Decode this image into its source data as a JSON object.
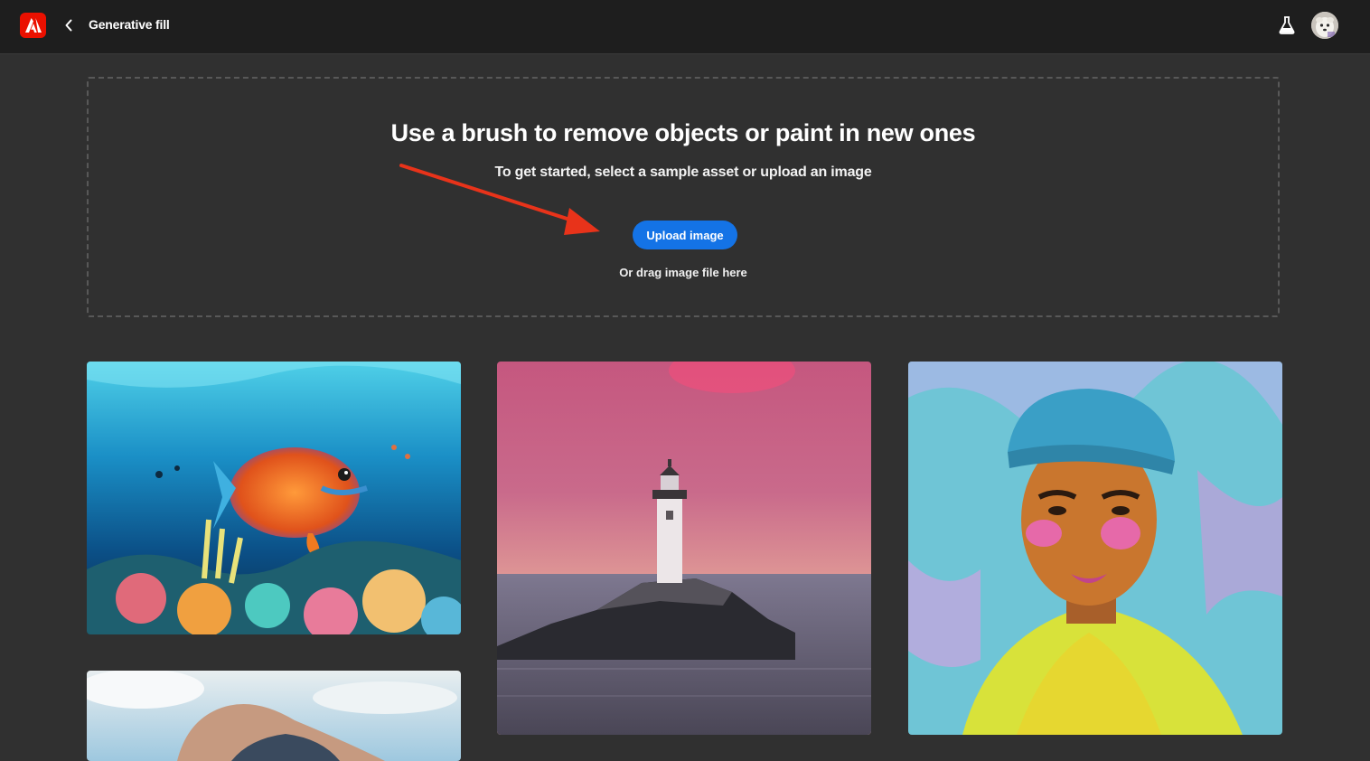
{
  "header": {
    "logo_icon": "adobe-logo-icon",
    "back_icon": "chevron-left-icon",
    "title": "Generative fill",
    "labs_icon": "flask-icon",
    "avatar_icon": "user-avatar"
  },
  "upload": {
    "title": "Use a brush to remove objects or paint in new ones",
    "subtitle": "To get started, select a sample asset or upload an image",
    "button_label": "Upload image",
    "drag_hint": "Or drag image file here",
    "annotation_icon": "red-arrow-icon"
  },
  "samples": [
    {
      "subject": "underwater-fish"
    },
    {
      "subject": "lighthouse-sunset"
    },
    {
      "subject": "pop-art-portrait"
    },
    {
      "subject": "sky-hand"
    }
  ],
  "colors": {
    "accent": "#1473e6",
    "brand": "#eb1000",
    "annotation": "#e8331a",
    "background": "#303030",
    "header": "#1e1e1e"
  }
}
